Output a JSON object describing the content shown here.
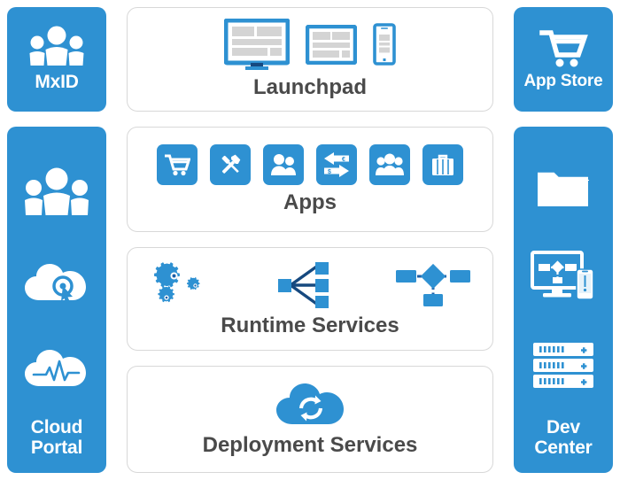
{
  "colors": {
    "brand_blue": "#2E91D2",
    "dark_navy": "#1B5FA8",
    "deep_navy": "#16497F",
    "panel_border": "#d8d8d8",
    "label_gray": "#4A4A4A",
    "screen_gray": "#d4d4d4",
    "white": "#ffffff"
  },
  "tiles": {
    "mxid": {
      "label": "MxID",
      "icon": "people-group-icon"
    },
    "app_store": {
      "label": "App Store",
      "icon": "shopping-cart-icon"
    },
    "cloud_portal": {
      "label": "Cloud Portal",
      "label_line1": "Cloud",
      "label_line2": "Portal",
      "icons": [
        "people-group-icon",
        "cloud-click-target-icon",
        "cloud-pulse-monitor-icon"
      ]
    },
    "dev_center": {
      "label": "Dev Center",
      "label_line1": "Dev",
      "label_line2": "Center",
      "icons": [
        "folder-icon",
        "monitor-workflow-mobile-icon",
        "server-rack-icon"
      ]
    }
  },
  "panels": [
    {
      "id": "launchpad",
      "label": "Launchpad",
      "icons": [
        "desktop-monitor-icon",
        "tablet-icon",
        "smartphone-icon"
      ]
    },
    {
      "id": "apps",
      "label": "Apps",
      "icons": [
        "shopping-cart-icon",
        "tools-hammer-screwdriver-icon",
        "two-people-icon",
        "currency-exchange-icon",
        "three-people-icon",
        "briefcase-icon"
      ]
    },
    {
      "id": "runtime-services",
      "label": "Runtime Services",
      "icons": [
        "gears-icon",
        "branching-tree-icon",
        "workflow-diagram-icon"
      ]
    },
    {
      "id": "deployment-services",
      "label": "Deployment Services",
      "icons": [
        "cloud-sync-icon"
      ]
    }
  ],
  "currency_symbols": {
    "left_arrow": "€",
    "right_arrow": "$"
  }
}
